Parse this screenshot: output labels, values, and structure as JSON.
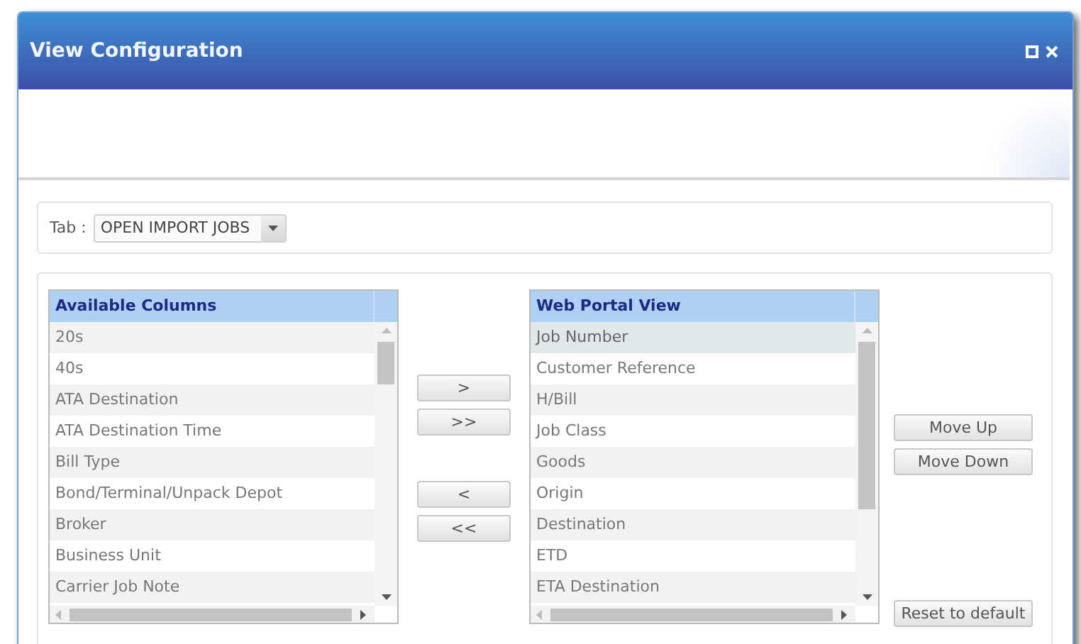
{
  "window": {
    "title": "View Configuration"
  },
  "tab_selector": {
    "label": "Tab :",
    "value": "OPEN IMPORT JOBS"
  },
  "available_columns": {
    "header": "Available Columns",
    "items": [
      {
        "label": "20s",
        "selected": false
      },
      {
        "label": "40s",
        "selected": false
      },
      {
        "label": "ATA Destination",
        "selected": false
      },
      {
        "label": "ATA Destination Time",
        "selected": false
      },
      {
        "label": "Bill Type",
        "selected": false
      },
      {
        "label": "Bond/Terminal/Unpack Depot",
        "selected": false
      },
      {
        "label": "Broker",
        "selected": false
      },
      {
        "label": "Business Unit",
        "selected": false
      },
      {
        "label": "Carrier Job Note",
        "selected": false
      }
    ]
  },
  "transfer_buttons": [
    ">",
    ">>",
    "<",
    "<<"
  ],
  "web_portal_view": {
    "header": "Web Portal View",
    "items": [
      {
        "label": "Job Number",
        "selected": true
      },
      {
        "label": "Customer Reference",
        "selected": false
      },
      {
        "label": "H/Bill",
        "selected": false
      },
      {
        "label": "Job Class",
        "selected": false
      },
      {
        "label": "Goods",
        "selected": false
      },
      {
        "label": "Origin",
        "selected": false
      },
      {
        "label": "Destination",
        "selected": false
      },
      {
        "label": "ETD",
        "selected": false
      },
      {
        "label": "ETA Destination",
        "selected": false
      }
    ]
  },
  "order_buttons": [
    "Move Up",
    "Move Down"
  ],
  "reset_button": "Reset to default"
}
